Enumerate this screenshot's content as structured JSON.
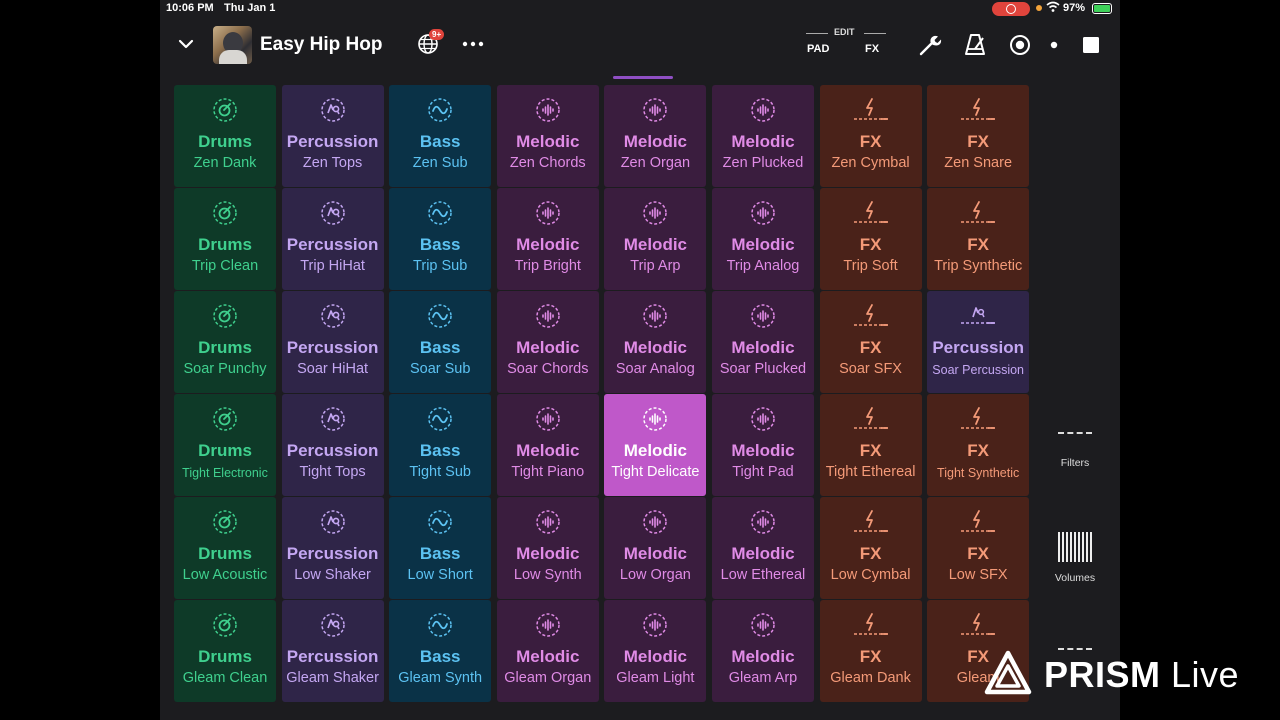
{
  "status_bar": {
    "time": "10:06 PM",
    "date": "Thu Jan 1",
    "battery": "97%"
  },
  "header": {
    "title": "Easy Hip Hop",
    "notification_badge": "9+",
    "edit_label": "EDIT",
    "pad_label": "PAD",
    "fx_label": "FX"
  },
  "colors": {
    "drums": "#3fd08e",
    "percussion": "#c4a7f2",
    "bass": "#5cc2f2",
    "melodic": "#e08be6",
    "fx": "#f49a78",
    "active": "#bf58c9"
  },
  "pads": [
    [
      {
        "type": "drums",
        "category": "Drums",
        "name": "Zen Dank"
      },
      {
        "type": "perc",
        "category": "Percussion",
        "name": "Zen Tops"
      },
      {
        "type": "bass",
        "category": "Bass",
        "name": "Zen Sub"
      },
      {
        "type": "mel",
        "category": "Melodic",
        "name": "Zen Chords"
      },
      {
        "type": "mel",
        "category": "Melodic",
        "name": "Zen Organ"
      },
      {
        "type": "mel",
        "category": "Melodic",
        "name": "Zen Plucked"
      },
      {
        "type": "fx",
        "category": "FX",
        "name": "Zen Cymbal"
      },
      {
        "type": "fx",
        "category": "FX",
        "name": "Zen Snare"
      }
    ],
    [
      {
        "type": "drums",
        "category": "Drums",
        "name": "Trip Clean"
      },
      {
        "type": "perc",
        "category": "Percussion",
        "name": "Trip HiHat"
      },
      {
        "type": "bass",
        "category": "Bass",
        "name": "Trip Sub"
      },
      {
        "type": "mel",
        "category": "Melodic",
        "name": "Trip Bright"
      },
      {
        "type": "mel",
        "category": "Melodic",
        "name": "Trip Arp"
      },
      {
        "type": "mel",
        "category": "Melodic",
        "name": "Trip Analog"
      },
      {
        "type": "fx",
        "category": "FX",
        "name": "Trip Soft"
      },
      {
        "type": "fx",
        "category": "FX",
        "name": "Trip Synthetic"
      }
    ],
    [
      {
        "type": "drums",
        "category": "Drums",
        "name": "Soar Punchy"
      },
      {
        "type": "perc",
        "category": "Percussion",
        "name": "Soar HiHat"
      },
      {
        "type": "bass",
        "category": "Bass",
        "name": "Soar Sub"
      },
      {
        "type": "mel",
        "category": "Melodic",
        "name": "Soar Chords"
      },
      {
        "type": "mel",
        "category": "Melodic",
        "name": "Soar Analog"
      },
      {
        "type": "mel",
        "category": "Melodic",
        "name": "Soar Plucked"
      },
      {
        "type": "fx",
        "category": "FX",
        "name": "Soar SFX"
      },
      {
        "type": "perc",
        "category": "Percussion",
        "name": "Soar Percussion",
        "icon": "perc-line"
      }
    ],
    [
      {
        "type": "drums",
        "category": "Drums",
        "name": "Tight Electronic"
      },
      {
        "type": "perc",
        "category": "Percussion",
        "name": "Tight Tops"
      },
      {
        "type": "bass",
        "category": "Bass",
        "name": "Tight Sub"
      },
      {
        "type": "mel",
        "category": "Melodic",
        "name": "Tight Piano"
      },
      {
        "type": "mel",
        "category": "Melodic",
        "name": "Tight Delicate",
        "active": true
      },
      {
        "type": "mel",
        "category": "Melodic",
        "name": "Tight Pad"
      },
      {
        "type": "fx",
        "category": "FX",
        "name": "Tight Ethereal"
      },
      {
        "type": "fx",
        "category": "FX",
        "name": "Tight Synthetic"
      }
    ],
    [
      {
        "type": "drums",
        "category": "Drums",
        "name": "Low Acoustic"
      },
      {
        "type": "perc",
        "category": "Percussion",
        "name": "Low Shaker"
      },
      {
        "type": "bass",
        "category": "Bass",
        "name": "Low Short"
      },
      {
        "type": "mel",
        "category": "Melodic",
        "name": "Low Synth"
      },
      {
        "type": "mel",
        "category": "Melodic",
        "name": "Low Organ"
      },
      {
        "type": "mel",
        "category": "Melodic",
        "name": "Low Ethereal"
      },
      {
        "type": "fx",
        "category": "FX",
        "name": "Low Cymbal"
      },
      {
        "type": "fx",
        "category": "FX",
        "name": "Low SFX"
      }
    ],
    [
      {
        "type": "drums",
        "category": "Drums",
        "name": "Gleam Clean"
      },
      {
        "type": "perc",
        "category": "Percussion",
        "name": "Gleam Shaker"
      },
      {
        "type": "bass",
        "category": "Bass",
        "name": "Gleam Synth"
      },
      {
        "type": "mel",
        "category": "Melodic",
        "name": "Gleam Organ"
      },
      {
        "type": "mel",
        "category": "Melodic",
        "name": "Gleam Light"
      },
      {
        "type": "mel",
        "category": "Melodic",
        "name": "Gleam Arp"
      },
      {
        "type": "fx",
        "category": "FX",
        "name": "Gleam Dank"
      },
      {
        "type": "fx",
        "category": "FX",
        "name": "Gleam"
      }
    ]
  ],
  "side_panel": {
    "filters_label": "Filters",
    "volumes_label": "Volumes"
  },
  "watermark": {
    "brand": "PRISM",
    "product": "Live"
  }
}
